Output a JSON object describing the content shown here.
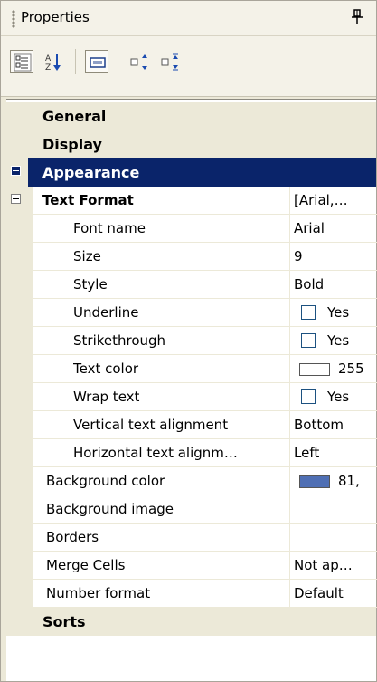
{
  "panel": {
    "title": "Properties",
    "pin_icon": "pushpin-icon"
  },
  "toolbar": {
    "buttons": [
      {
        "name": "categorized-button",
        "icon": "categorized-icon",
        "pressed": true
      },
      {
        "name": "alphabetical-button",
        "icon": "sort-az-icon",
        "pressed": false
      },
      {
        "name": "property-pages-button",
        "icon": "property-pages-icon",
        "pressed": true
      },
      {
        "name": "expand-all-button",
        "icon": "expand-all-icon",
        "pressed": false
      },
      {
        "name": "collapse-all-button",
        "icon": "collapse-all-icon",
        "pressed": false
      }
    ]
  },
  "colors": {
    "selection": "#0a246a",
    "gutter": "#ece9d8",
    "white_swatch": "#ffffff",
    "blue_swatch": "#4f6fb4"
  },
  "grid": {
    "categories": {
      "general": "General",
      "display": "Display",
      "appearance": "Appearance",
      "sorts": "Sorts"
    },
    "text_format": {
      "label": "Text Format",
      "value": "[Arial,…"
    },
    "text_format_props": [
      {
        "label": "Font name",
        "value": "Arial"
      },
      {
        "label": "Size",
        "value": "9"
      },
      {
        "label": "Style",
        "value": "Bold"
      },
      {
        "label": "Underline",
        "value": "Yes"
      },
      {
        "label": "Strikethrough",
        "value": "Yes"
      },
      {
        "label": "Text color",
        "value": "255"
      },
      {
        "label": "Wrap text",
        "value": "Yes"
      },
      {
        "label": "Vertical text alignment",
        "value": "Bottom"
      },
      {
        "label": "Horizontal text alignm…",
        "value": "Left"
      }
    ],
    "appearance_props": [
      {
        "label": "Background color",
        "value": "81,"
      },
      {
        "label": "Background image",
        "value": ""
      },
      {
        "label": "Borders",
        "value": ""
      },
      {
        "label": "Merge Cells",
        "value": "Not ap…"
      },
      {
        "label": "Number format",
        "value": "Default"
      }
    ]
  }
}
